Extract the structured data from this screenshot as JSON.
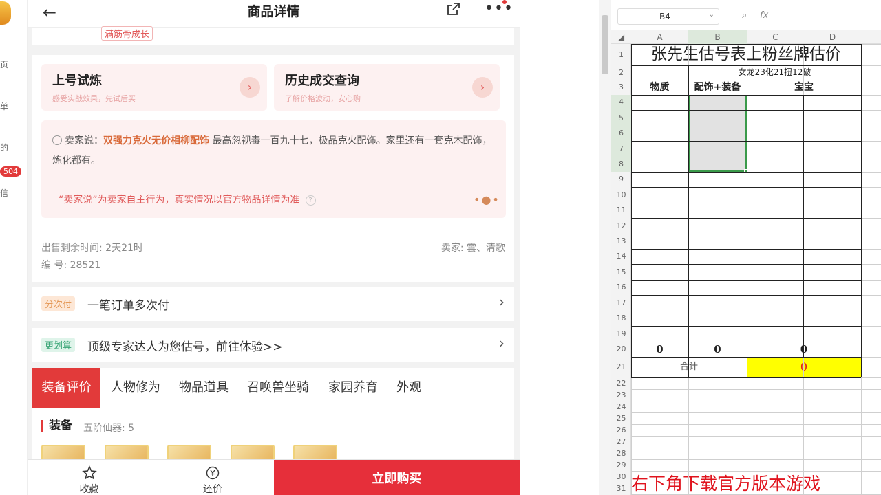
{
  "app": {
    "title": "商品详情",
    "growth_tag": "满筋骨成长",
    "features": [
      {
        "title": "上号试炼",
        "subtitle": "感受实战效果，先试后买"
      },
      {
        "title": "历史成交查询",
        "subtitle": "了解价格波动，安心购"
      }
    ],
    "seller_says": {
      "label": "卖家说：",
      "highlight": "双强力克火无价相柳配饰",
      "text": "最高忽视毒一百九十七，极品克火配饰。家里还有一套克木配饰，炼化都有。",
      "disclaimer": "“卖家说”为卖家自主行为，真实情况以官方物品详情为准"
    },
    "remaining_time": "出售剩余时间: 2天21时",
    "seller": "卖家: 雲、清歌",
    "serial": "编 号: 28521",
    "pay_row": {
      "tag": "分次付",
      "text": "一笔订单多次付"
    },
    "estimate_row": {
      "tag": "更划算",
      "text": "顶级专家达人为您估号，前往体验>>"
    },
    "tabs": [
      "装备评价",
      "人物修为",
      "物品道具",
      "召唤兽坐骑",
      "家园养育",
      "外观"
    ],
    "equip": {
      "title": "装备",
      "subtitle": "五阶仙器: 5"
    },
    "bottom": {
      "favorite": "收藏",
      "bargain": "还价",
      "buy": "立即购买"
    }
  },
  "left_strip": {
    "labels": [
      "页",
      "单",
      "的",
      "信"
    ],
    "badge": "504"
  },
  "sheet": {
    "name_box": "B4",
    "fx": "fx",
    "columns": [
      "A",
      "B",
      "C",
      "D"
    ],
    "rows": [
      "1",
      "2",
      "3",
      "4",
      "5",
      "6",
      "7",
      "8",
      "9",
      "10",
      "11",
      "12",
      "13",
      "14",
      "15",
      "16",
      "17",
      "18",
      "19",
      "20",
      "21",
      "22",
      "23",
      "24",
      "25",
      "26",
      "27",
      "28",
      "29",
      "30",
      "31"
    ],
    "title": "张先生估号表上粉丝牌估价",
    "subtitle": "女龙23化21扭12破",
    "headers": [
      "物质",
      "配饰+装备",
      "宝宝"
    ],
    "row20": [
      "0",
      "0",
      "0"
    ],
    "total_label": "合计",
    "total_value": "0"
  },
  "watermark": "右下角下载官方版本游戏",
  "colors": {
    "accent": "#e62f3a",
    "selection": "#3a9a4a",
    "highlight": "#ffff00"
  }
}
